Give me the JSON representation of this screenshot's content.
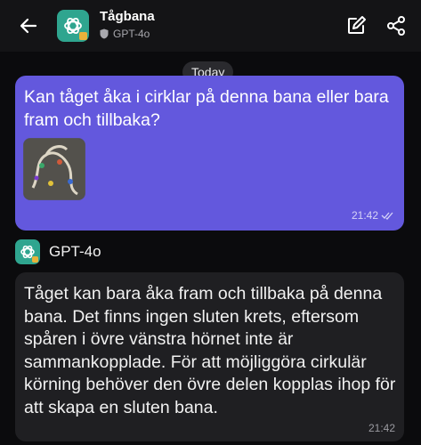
{
  "header": {
    "title": "Tågbana",
    "model": "GPT-4o",
    "icons": [
      "back-arrow-icon",
      "edit-icon",
      "share-icon"
    ]
  },
  "chat": {
    "date_label": "Today",
    "user_message": {
      "text": "Kan tåget åka i cirklar på denna bana eller bara fram och tillbaka?",
      "time": "21:42",
      "attachment": "image-thumbnail"
    },
    "bot_name": "GPT-4o",
    "bot_message": {
      "text": "Tåget kan bara åka fram och tillbaka på denna bana. Det finns ingen sluten krets, eftersom spåren i övre vänstra hörnet inte är sammankopplade. För att möjliggöra cirkulär körning behöver den övre delen kopplas ihop för att skapa en sluten bana.",
      "time": "21:42"
    }
  },
  "colors": {
    "background": "#0b0b0d",
    "header": "#141416",
    "user_bubble": "#6358dd",
    "bot_bubble": "#1f1f22",
    "avatar": "#2fa58f"
  }
}
